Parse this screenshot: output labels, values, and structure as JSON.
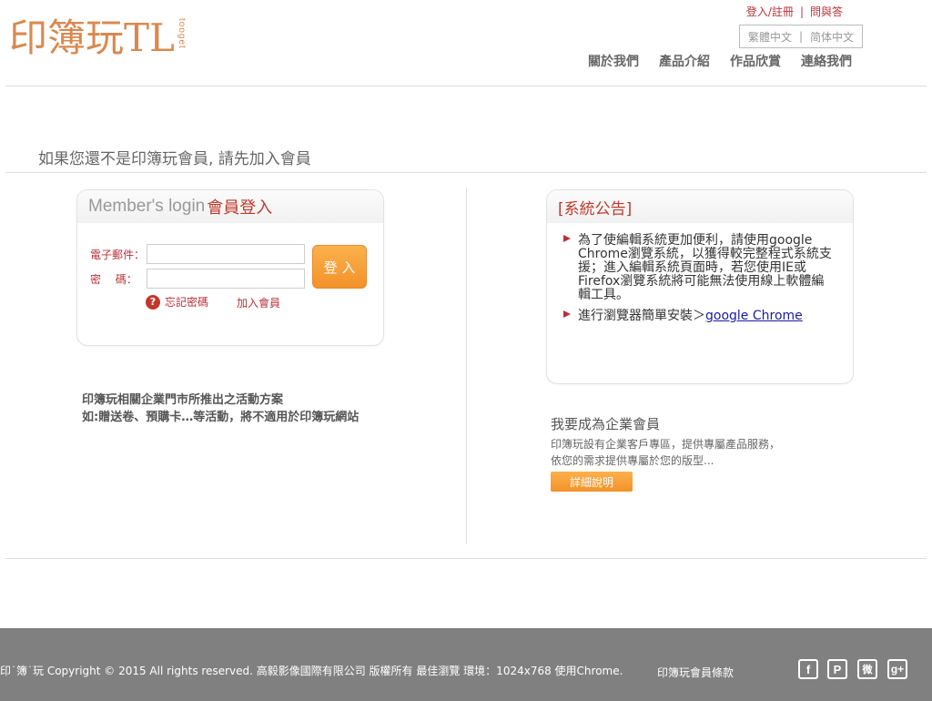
{
  "brand": {
    "logo_text": "印簿玩TL",
    "logo_sub": "tooget",
    "logo_color": "#d9894f"
  },
  "top_links": {
    "login_register": "登入/註冊",
    "separator": "|",
    "faq": "問與答"
  },
  "language": {
    "traditional": "繁體中文",
    "separator": "|",
    "simplified": "简体中文"
  },
  "nav": {
    "items": [
      "關於我們",
      "產品介紹",
      "作品欣賞",
      "連絡我們"
    ]
  },
  "page": {
    "heading": "如果您還不是印簿玩會員, 請先加入會員"
  },
  "login": {
    "title_en": "Member's login",
    "title_zh": "會員登入",
    "email_label": "電子郵件：",
    "password_label": "密　 碼：",
    "email_value": "",
    "password_value": "",
    "submit_label": "登 入",
    "forgot_label": "忘記密碼",
    "forgot_icon": "question-icon",
    "join_label": "加入會員"
  },
  "promo": {
    "line1": "印簿玩相關企業門市所推出之活動方案",
    "line2": "如:贈送卷、預購卡…等活動，將不適用於印簿玩網站"
  },
  "notice": {
    "title": "[系統公告]",
    "item1": "為了使編輯系統更加便利，請使用google Chrome瀏覽系統，以獲得較完整程式系統支援；進入編輯系統頁面時，若您使用IE或Firefox瀏覽系統將可能無法使用線上軟體編輯工具。",
    "item2_prefix": "進行瀏覽器簡單安裝＞",
    "item2_link": "google Chrome"
  },
  "business": {
    "title": "我要成為企業會員",
    "desc_line1": "印簿玩設有企業客戶專區，提供專屬產品服務，",
    "desc_line2": "依您的需求提供專屬於您的版型...",
    "button": "詳細說明"
  },
  "footer": {
    "copyright": "印˙簿˙玩 Copyright © 2015 All rights reserved. 高毅影像國際有限公司 版權所有  最佳瀏覽 環境：1024x768 使用Chrome.",
    "terms": "印簿玩會員條款",
    "social": [
      {
        "icon": "facebook-icon",
        "glyph": "f"
      },
      {
        "icon": "plurk-icon",
        "glyph": "P"
      },
      {
        "icon": "weibo-icon",
        "glyph": "微"
      },
      {
        "icon": "google-plus-icon",
        "glyph": "g+"
      }
    ]
  },
  "colors": {
    "accent_red": "#b8323a",
    "accent_orange": "#f3922a",
    "footer_bg": "#808080"
  }
}
